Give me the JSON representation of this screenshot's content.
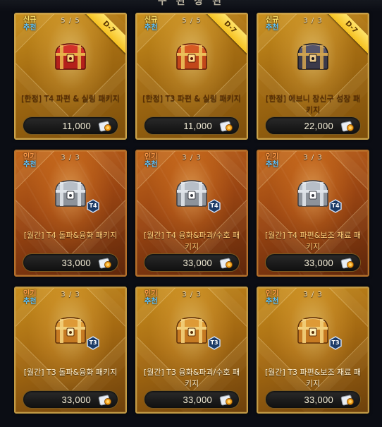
{
  "header": {
    "title_partial": "구 된 상 된"
  },
  "colors": {
    "accent_gold": "#f6c120",
    "new_badge": "#ffe36a",
    "popular_badge": "#ff9d4a",
    "recommend_badge": "#61c7ff"
  },
  "products": [
    {
      "badge": "신규",
      "badge2": "추천",
      "count": "5 / 5",
      "ribbon": "D-7",
      "name": "[한정] T4 파편 & 실링 패키지",
      "price": "11,000",
      "style": "gold",
      "chest": "red",
      "tier": ""
    },
    {
      "badge": "신규",
      "badge2": "추천",
      "count": "5 / 5",
      "ribbon": "D-7",
      "name": "[한정] T3 파편 & 실링 패키지",
      "price": "11,000",
      "style": "gold",
      "chest": "orange-red",
      "tier": ""
    },
    {
      "badge": "신규",
      "badge2": "추천",
      "count": "3 / 3",
      "ribbon": "D-7",
      "name": "[한정] 에브니 장신구 성장 패키지",
      "price": "22,000",
      "style": "gold",
      "chest": "dark",
      "tier": ""
    },
    {
      "badge": "인기",
      "badge2": "추천",
      "count": "3 / 3",
      "ribbon": "",
      "name": "[월간] T4 돌파&융화 패키지",
      "price": "33,000",
      "style": "orange",
      "chest": "silver",
      "tier": "T4"
    },
    {
      "badge": "인기",
      "badge2": "추천",
      "count": "3 / 3",
      "ribbon": "",
      "name": "[월간] T4 융화&파괴/수호 패키지",
      "price": "33,000",
      "style": "orange",
      "chest": "silver",
      "tier": "T4"
    },
    {
      "badge": "인기",
      "badge2": "추천",
      "count": "3 / 3",
      "ribbon": "",
      "name": "[월간] T4 파편&보조 재료 패키지",
      "price": "33,000",
      "style": "orange",
      "chest": "silver",
      "tier": "T4"
    },
    {
      "badge": "인기",
      "badge2": "추천",
      "count": "3 / 3",
      "ribbon": "",
      "name": "[월간] T3 돌파&융화 패키지",
      "price": "33,000",
      "style": "mixed",
      "chest": "gold",
      "tier": "T3"
    },
    {
      "badge": "인기",
      "badge2": "추천",
      "count": "3 / 3",
      "ribbon": "",
      "name": "[월간] T3 융화&파괴/수호 패키지",
      "price": "33,000",
      "style": "mixed",
      "chest": "gold",
      "tier": "T3"
    },
    {
      "badge": "인기",
      "badge2": "추천",
      "count": "3 / 3",
      "ribbon": "",
      "name": "[월간] T3 파편&보조 재료 패키지",
      "price": "33,000",
      "style": "mixed",
      "chest": "gold",
      "tier": "T3"
    }
  ],
  "icons": {
    "currency": "gem-coin-icon",
    "chest": "treasure-chest-icon",
    "tier": "tier-hexagon-icon"
  }
}
